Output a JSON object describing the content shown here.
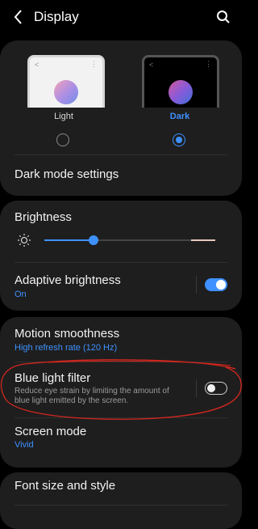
{
  "header": {
    "title": "Display",
    "back_icon": "chevron-left-icon",
    "search_icon": "search-icon"
  },
  "theme": {
    "light": {
      "label": "Light",
      "selected": false
    },
    "dark": {
      "label": "Dark",
      "selected": true
    },
    "dark_mode_settings": "Dark mode settings"
  },
  "brightness": {
    "title": "Brightness",
    "level": 0.29,
    "adaptive": {
      "title": "Adaptive brightness",
      "status": "On",
      "enabled": true
    }
  },
  "motion": {
    "title": "Motion smoothness",
    "value": "High refresh rate (120 Hz)"
  },
  "blue_light": {
    "title": "Blue light filter",
    "desc": "Reduce eye strain by limiting the amount of blue light emitted by the screen.",
    "enabled": false
  },
  "screen_mode": {
    "title": "Screen mode",
    "value": "Vivid"
  },
  "font": {
    "title": "Font size and style"
  },
  "colors": {
    "accent": "#3e91ff",
    "annotation": "#d4271f",
    "card": "#1e1e1e"
  }
}
